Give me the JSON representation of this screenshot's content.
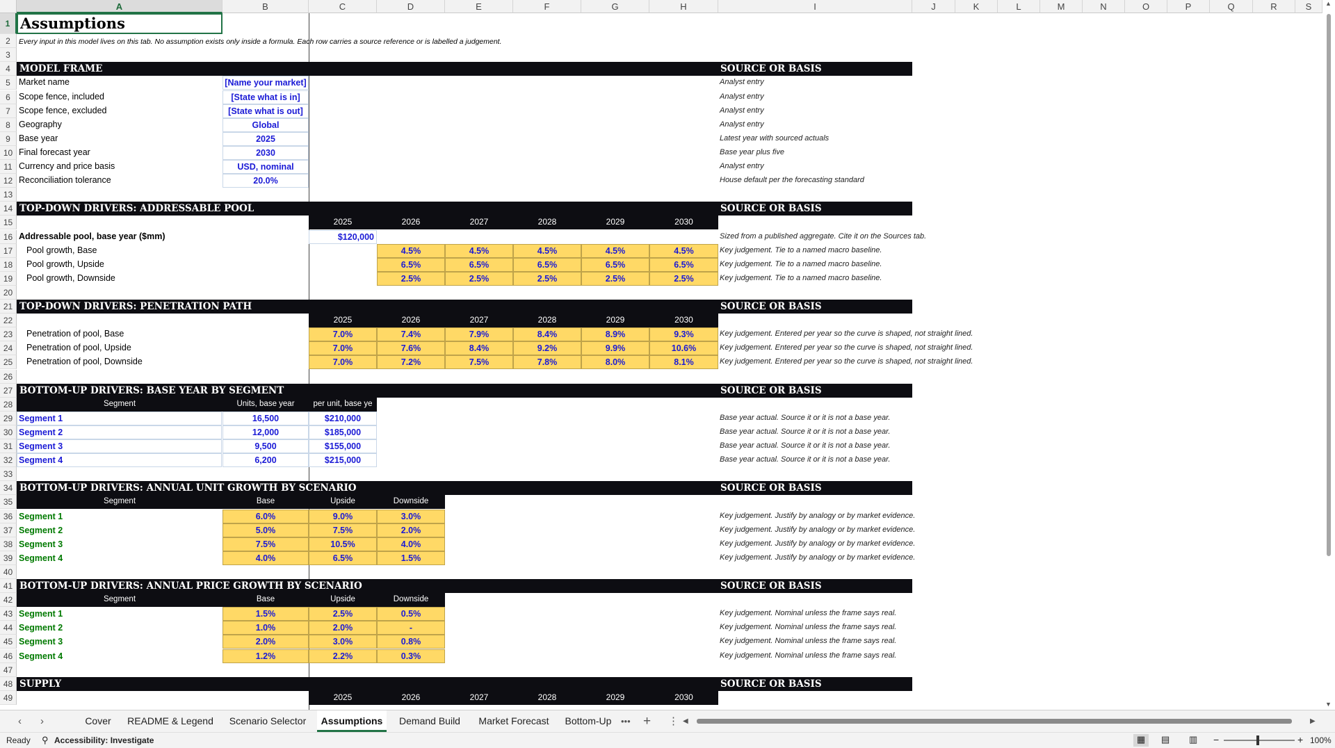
{
  "columns": [
    "A",
    "B",
    "C",
    "D",
    "E",
    "F",
    "G",
    "H",
    "I",
    "J",
    "K",
    "L",
    "M",
    "N",
    "O",
    "P",
    "Q",
    "R",
    "S"
  ],
  "title": "Assumptions",
  "subtitle": "Every input in this model lives on this tab. No assumption exists only inside a formula. Each row carries a source reference or is labelled a judgement.",
  "source_header": "SOURCE OR BASIS",
  "years": [
    "2025",
    "2026",
    "2027",
    "2028",
    "2029",
    "2030"
  ],
  "model_frame": {
    "title": "MODEL FRAME",
    "rows": [
      {
        "label": "Market name",
        "value": "[Name your market]",
        "note": "Analyst entry"
      },
      {
        "label": "Scope fence, included",
        "value": "[State what is in]",
        "note": "Analyst entry"
      },
      {
        "label": "Scope fence, excluded",
        "value": "[State what is out]",
        "note": "Analyst entry"
      },
      {
        "label": "Geography",
        "value": "Global",
        "note": "Analyst entry"
      },
      {
        "label": "Base year",
        "value": "2025",
        "note": "Latest year with sourced actuals"
      },
      {
        "label": "Final forecast year",
        "value": "2030",
        "note": "Base year plus five"
      },
      {
        "label": "Currency and price basis",
        "value": "USD, nominal",
        "note": "Analyst entry"
      },
      {
        "label": "Reconciliation tolerance",
        "value": "20.0%",
        "note": "House default per the forecasting standard"
      }
    ]
  },
  "pool": {
    "title": "TOP-DOWN DRIVERS: ADDRESSABLE POOL",
    "base_label": "Addressable pool, base year ($mm)",
    "base_value": "$120,000",
    "base_note": "Sized from a published aggregate. Cite it on the Sources tab.",
    "rows": [
      {
        "label": "Pool growth, Base",
        "values": [
          "4.5%",
          "4.5%",
          "4.5%",
          "4.5%",
          "4.5%"
        ],
        "note": "Key judgement. Tie to a named macro baseline."
      },
      {
        "label": "Pool growth, Upside",
        "values": [
          "6.5%",
          "6.5%",
          "6.5%",
          "6.5%",
          "6.5%"
        ],
        "note": "Key judgement. Tie to a named macro baseline."
      },
      {
        "label": "Pool growth, Downside",
        "values": [
          "2.5%",
          "2.5%",
          "2.5%",
          "2.5%",
          "2.5%"
        ],
        "note": "Key judgement. Tie to a named macro baseline."
      }
    ]
  },
  "penetration": {
    "title": "TOP-DOWN DRIVERS: PENETRATION PATH",
    "rows": [
      {
        "label": "Penetration of pool, Base",
        "values": [
          "7.0%",
          "7.4%",
          "7.9%",
          "8.4%",
          "8.9%",
          "9.3%"
        ],
        "note": "Key judgement. Entered per year so the curve is shaped, not straight lined."
      },
      {
        "label": "Penetration of pool, Upside",
        "values": [
          "7.0%",
          "7.6%",
          "8.4%",
          "9.2%",
          "9.9%",
          "10.6%"
        ],
        "note": "Key judgement. Entered per year so the curve is shaped, not straight lined."
      },
      {
        "label": "Penetration of pool, Downside",
        "values": [
          "7.0%",
          "7.2%",
          "7.5%",
          "7.8%",
          "8.0%",
          "8.1%"
        ],
        "note": "Key judgement. Entered per year so the curve is shaped, not straight lined."
      }
    ]
  },
  "bu_base": {
    "title": "BOTTOM-UP DRIVERS: BASE YEAR BY SEGMENT",
    "headers": [
      "Segment",
      "Units, base year",
      "per unit, base ye"
    ],
    "rows": [
      {
        "segment": "Segment 1",
        "units": "16,500",
        "price": "$210,000",
        "note": "Base year actual. Source it or it is not a base year."
      },
      {
        "segment": "Segment 2",
        "units": "12,000",
        "price": "$185,000",
        "note": "Base year actual. Source it or it is not a base year."
      },
      {
        "segment": "Segment 3",
        "units": "9,500",
        "price": "$155,000",
        "note": "Base year actual. Source it or it is not a base year."
      },
      {
        "segment": "Segment 4",
        "units": "6,200",
        "price": "$215,000",
        "note": "Base year actual. Source it or it is not a base year."
      }
    ]
  },
  "unit_growth": {
    "title": "BOTTOM-UP DRIVERS: ANNUAL UNIT GROWTH BY SCENARIO",
    "headers": [
      "Segment",
      "Base",
      "Upside",
      "Downside"
    ],
    "rows": [
      {
        "segment": "Segment 1",
        "values": [
          "6.0%",
          "9.0%",
          "3.0%"
        ],
        "note": "Key judgement. Justify by analogy or by market evidence."
      },
      {
        "segment": "Segment 2",
        "values": [
          "5.0%",
          "7.5%",
          "2.0%"
        ],
        "note": "Key judgement. Justify by analogy or by market evidence."
      },
      {
        "segment": "Segment 3",
        "values": [
          "7.5%",
          "10.5%",
          "4.0%"
        ],
        "note": "Key judgement. Justify by analogy or by market evidence."
      },
      {
        "segment": "Segment 4",
        "values": [
          "4.0%",
          "6.5%",
          "1.5%"
        ],
        "note": "Key judgement. Justify by analogy or by market evidence."
      }
    ]
  },
  "price_growth": {
    "title": "BOTTOM-UP DRIVERS: ANNUAL PRICE GROWTH BY SCENARIO",
    "headers": [
      "Segment",
      "Base",
      "Upside",
      "Downside"
    ],
    "rows": [
      {
        "segment": "Segment 1",
        "values": [
          "1.5%",
          "2.5%",
          "0.5%"
        ],
        "note": "Key judgement. Nominal unless the frame says real."
      },
      {
        "segment": "Segment 2",
        "values": [
          "1.0%",
          "2.0%",
          "-"
        ],
        "note": "Key judgement. Nominal unless the frame says real."
      },
      {
        "segment": "Segment 3",
        "values": [
          "2.0%",
          "3.0%",
          "0.8%"
        ],
        "note": "Key judgement. Nominal unless the frame says real."
      },
      {
        "segment": "Segment 4",
        "values": [
          "1.2%",
          "2.2%",
          "0.3%"
        ],
        "note": "Key judgement. Nominal unless the frame says real."
      }
    ]
  },
  "supply": {
    "title": "SUPPLY"
  },
  "tabs": [
    "Cover",
    "README & Legend",
    "Scenario Selector",
    "Assumptions",
    "Demand Build",
    "Market Forecast",
    "Bottom-Up"
  ],
  "active_tab": "Assumptions",
  "status": {
    "ready": "Ready",
    "accessibility": "Accessibility: Investigate",
    "zoom": "100%"
  },
  "colors": {
    "header_band": "#0d0d12",
    "input_fill": "#ffd966",
    "input_text": "#1a1ad6",
    "segment_green": "#007a00",
    "excel_green": "#217346"
  },
  "icons": [
    "tab-prev-icon",
    "tab-next-icon",
    "more-tabs-icon",
    "add-sheet-icon",
    "sheet-options-icon",
    "accessibility-icon",
    "normal-view-icon",
    "page-layout-icon",
    "page-break-icon",
    "zoom-out-icon",
    "zoom-in-icon"
  ]
}
